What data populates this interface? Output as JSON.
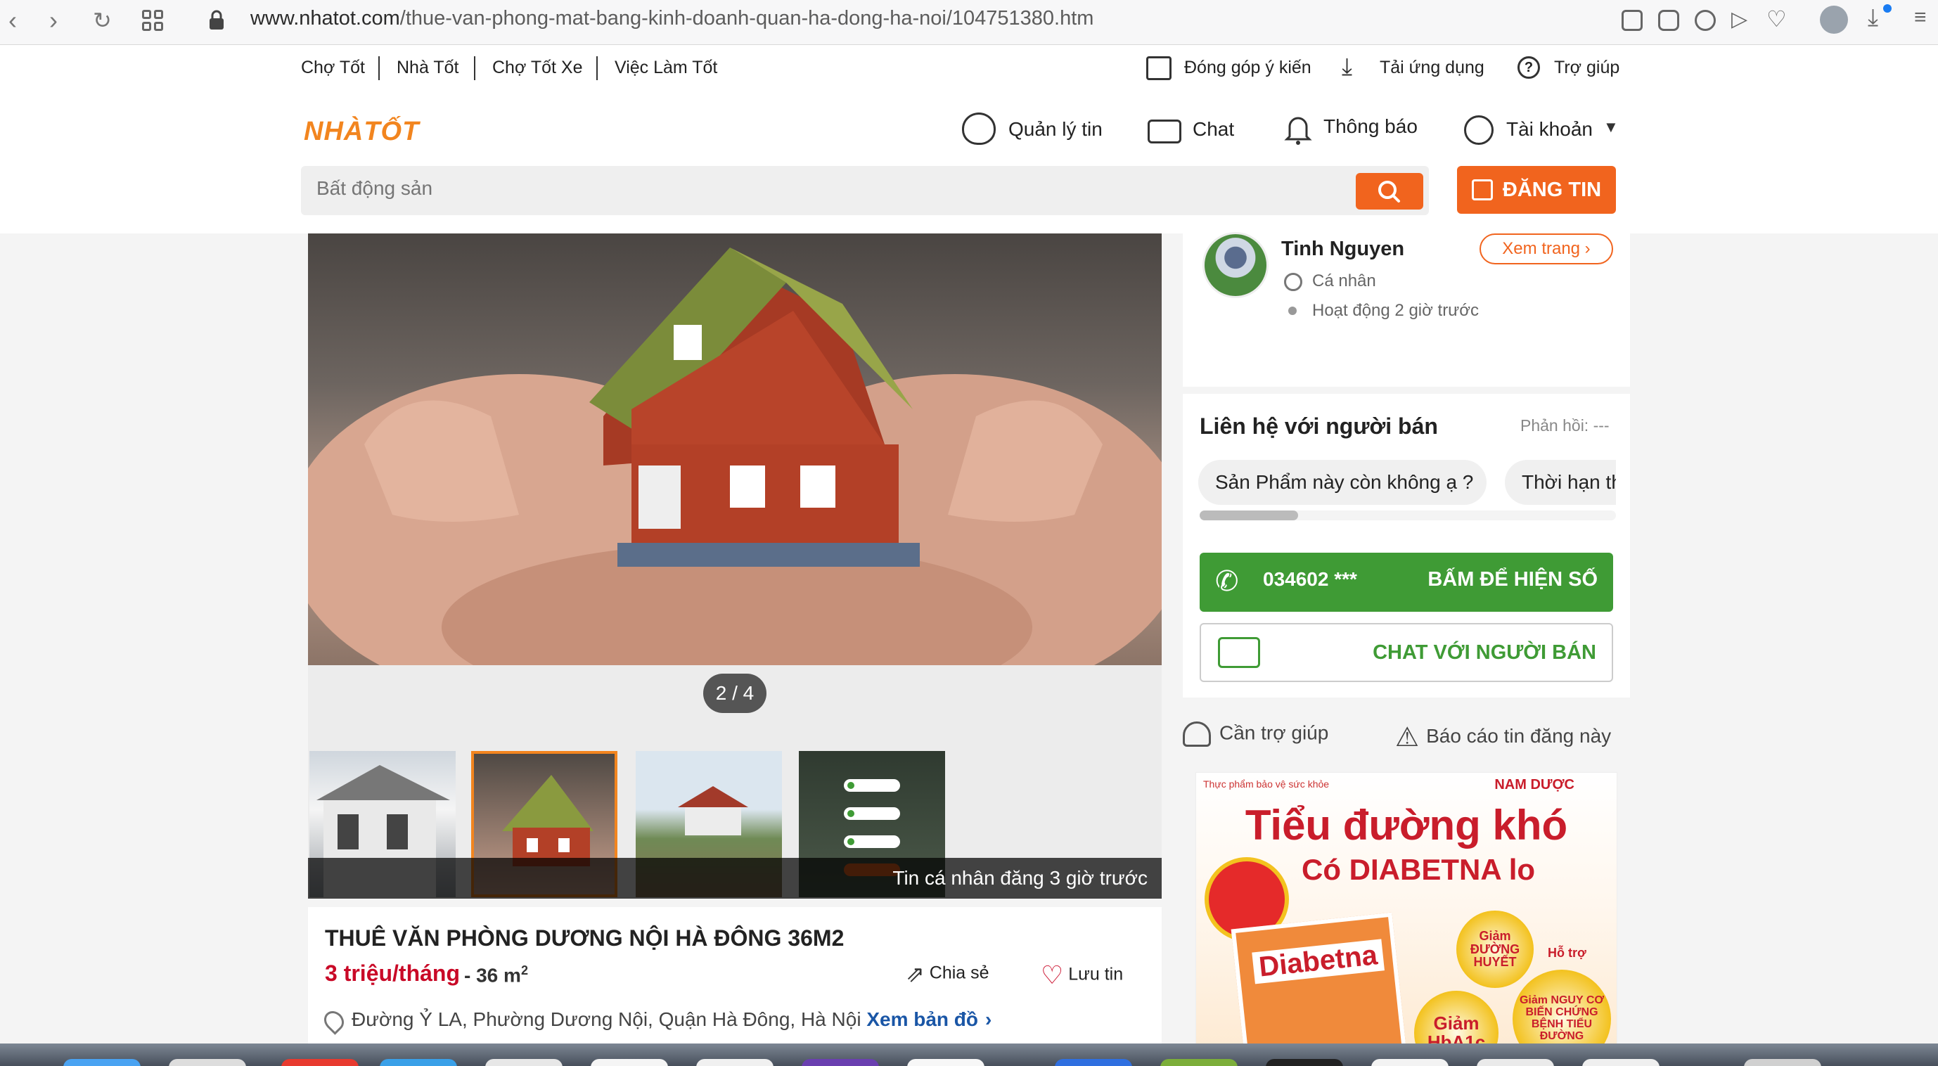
{
  "browser": {
    "url_host": "www.nhatot.com",
    "url_path": "/thue-van-phong-mat-bang-kinh-doanh-quan-ha-dong-ha-noi/104751380.htm"
  },
  "header": {
    "top_links": [
      "Chợ Tốt",
      "Nhà Tốt",
      "Chợ Tốt Xe",
      "Việc Làm Tốt"
    ],
    "feedback": "Đóng góp ý kiến",
    "download_app": "Tải ứng dụng",
    "help": "Trợ giúp",
    "logo": "NHÀTỐT",
    "manage_posts": "Quản lý tin",
    "chat": "Chat",
    "notifications": "Thông báo",
    "account": "Tài khoản",
    "search_placeholder": "Bất động sản",
    "post_button": "ĐĂNG TIN"
  },
  "gallery": {
    "counter": "2 / 4",
    "posted_info": "Tin cá nhân đăng 3 giờ trước",
    "thumbnail_count": 4,
    "selected_index": 2
  },
  "listing": {
    "title": "THUÊ VĂN PHÒNG DƯƠNG NỘI HÀ ĐÔNG 36M2",
    "price": "3 triệu/tháng",
    "area_prefix": "- 36 m",
    "area_sup": "2",
    "share_label": "Chia sẻ",
    "save_label": "Lưu tin",
    "address": "Đường Ỷ LA, Phường Dương Nội, Quận Hà Đông, Hà Nội",
    "map_link": "Xem bản đồ"
  },
  "seller": {
    "name": "Tinh Nguyen",
    "type": "Cá nhân",
    "active": "Hoạt động 2 giờ trước",
    "view_page": "Xem trang"
  },
  "contact": {
    "title": "Liên hệ với người bán",
    "response": "Phản hồi: ---",
    "quick_replies": [
      "Sản Phẩm này còn không ạ ?",
      "Thời hạn th"
    ],
    "phone": "034602 ***",
    "show_number": "BẤM ĐỂ HIỆN SỐ",
    "chat_seller": "CHAT VỚI NGƯỜI BÁN"
  },
  "support": {
    "help": "Cần trợ giúp",
    "report": "Báo cáo tin đăng này"
  },
  "ad": {
    "disclaimer": "Thực phẩm bảo vệ sức khỏe",
    "brand": "NAM DƯỢC",
    "headline": "Tiểu đường khó",
    "subline": "Có DIABETNA lo",
    "product": "Diabetna",
    "badges": [
      "Giảm ĐƯỜNG HUYẾT",
      "Hỗ trợ",
      "Giảm HbA1c",
      "Giảm NGUY CƠ BIẾN CHỨNG BỆNH TIỂU ĐƯỜNG"
    ]
  },
  "colors": {
    "brand_orange": "#f1641e",
    "price_red": "#c90927",
    "call_green": "#3f9b35",
    "link_blue": "#1a56a6"
  }
}
